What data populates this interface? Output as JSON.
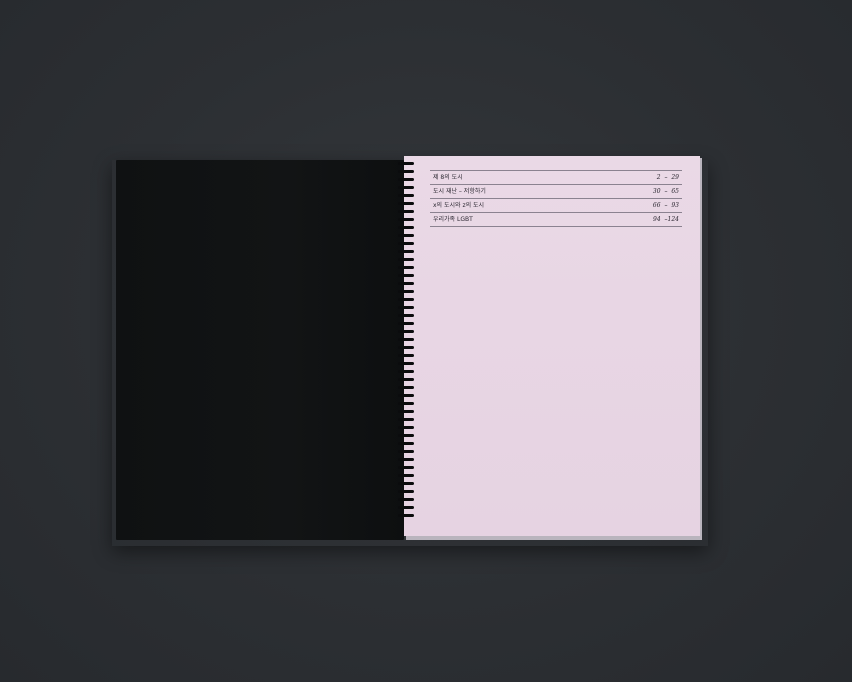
{
  "toc": {
    "entries": [
      {
        "title": "제 8의 도시",
        "pages": "2 – 29"
      },
      {
        "title": "도시 재난 – 저항하기",
        "pages": "30 – 65"
      },
      {
        "title": "x의 도시와 z의 도시",
        "pages": "66 – 93"
      },
      {
        "title": "우리가족 LGBT",
        "pages": "94 –124"
      }
    ]
  },
  "colors": {
    "background": "#2c2f33",
    "left_page": "#111314",
    "right_page": "#e8d6e4",
    "rule": "#8b8290",
    "text": "#2a2630"
  }
}
